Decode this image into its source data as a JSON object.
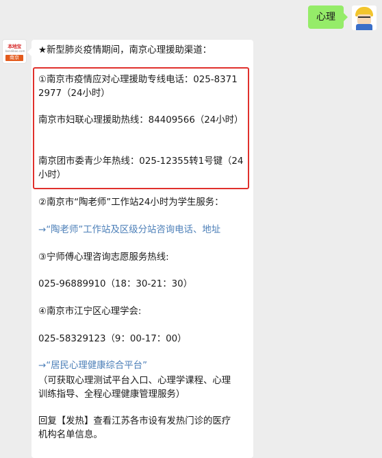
{
  "user_message": {
    "text": "心理"
  },
  "bot": {
    "avatar_logo": "本地宝",
    "avatar_sub": "bendibao.com",
    "avatar_city": "南京"
  },
  "message_lines": [
    "★新型肺炎疫情期间，南京心理援助渠道：",
    "①南京市疫情应对心理援助专线电话：025-8371",
    "2977（24小时）",
    "南京市妇联心理援助热线：84409566（24小时）",
    "南京团市委青少年热线：025-12355转1号键（24",
    "小时）",
    "②南京市“陶老师”工作站24小时为学生服务：",
    "→“陶老师”工作站及区级分站咨询电话、地址",
    "③宁师傅心理咨询志愿服务热线:",
    "025-96889910（18：30-21：30）",
    "④南京市江宁区心理学会:",
    "025-58329123（9：00-17：00）",
    "→“居民心理健康综合平台”",
    "（可获取心理测试平台入口、心理学课程、心理",
    "训练指导、全程心理健康管理服务）",
    "回复【发热】查看江苏各市设有发热门诊的医疗",
    "机构名单信息。"
  ]
}
